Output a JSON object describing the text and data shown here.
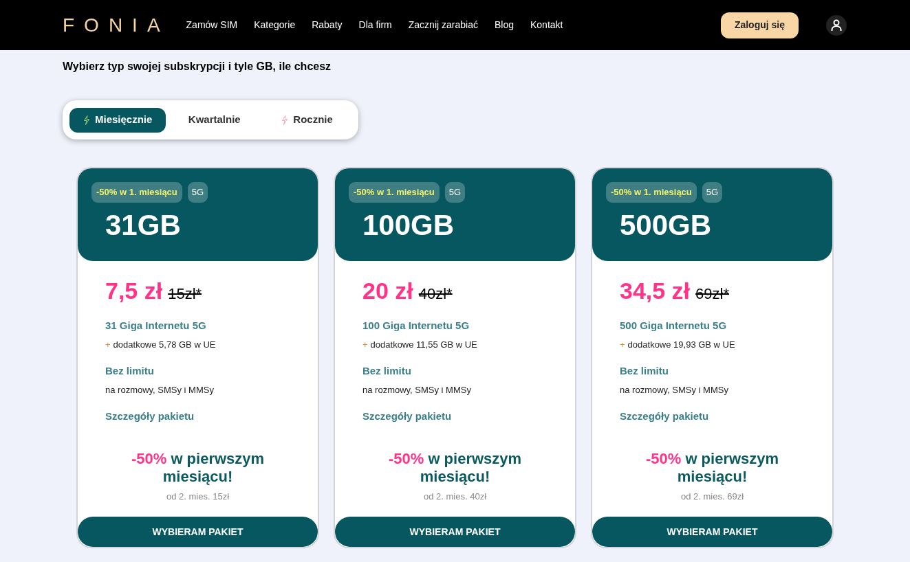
{
  "header": {
    "logo": "FONIA",
    "nav": [
      "Zamów SIM",
      "Kategorie",
      "Rabaty",
      "Dla firm",
      "Zacznij zarabiać",
      "Blog",
      "Kontakt"
    ],
    "login": "Zaloguj się"
  },
  "heading": "Wybierz typ swojej subskrypcji i tyle GB, ile chcesz",
  "tabs": [
    {
      "label": "Miesięcznie",
      "selected": true,
      "icon": true
    },
    {
      "label": "Kwartalnie",
      "selected": false,
      "icon": false
    },
    {
      "label": "Rocznie",
      "selected": false,
      "icon": true
    }
  ],
  "plans": [
    {
      "badge": "-50% w 1. miesiącu",
      "tag": "5G",
      "gb": "31GB",
      "price": "7,5 zł",
      "old_price": "15zł*",
      "data_title": "31 Giga Internetu 5G",
      "data_plus": "+",
      "data_extra": "dodatkowe 5,78 GB w UE",
      "limit_title": "Bez limitu",
      "limit_text": "na rozmowy, SMSy i MMSy",
      "details": "Szczegóły pakietu",
      "promo_highlight": "-50%",
      "promo_text": "w pierwszym miesiącu!",
      "after": "od 2. mies. 15zł",
      "button": "WYBIERAM PAKIET"
    },
    {
      "badge": "-50% w 1. miesiącu",
      "tag": "5G",
      "gb": "100GB",
      "price": "20 zł",
      "old_price": "40zł*",
      "data_title": "100 Giga Internetu 5G",
      "data_plus": "+",
      "data_extra": "dodatkowe 11,55 GB w UE",
      "limit_title": "Bez limitu",
      "limit_text": "na rozmowy, SMSy i MMSy",
      "details": "Szczegóły pakietu",
      "promo_highlight": "-50%",
      "promo_text": "w pierwszym miesiącu!",
      "after": "od 2. mies. 40zł",
      "button": "WYBIERAM PAKIET"
    },
    {
      "badge": "-50% w 1. miesiącu",
      "tag": "5G",
      "gb": "500GB",
      "price": "34,5 zł",
      "old_price": "69zł*",
      "data_title": "500 Giga Internetu 5G",
      "data_plus": "+",
      "data_extra": "dodatkowe 19,93 GB w UE",
      "limit_title": "Bez limitu",
      "limit_text": "na rozmowy, SMSy i MMSy",
      "details": "Szczegóły pakietu",
      "promo_highlight": "-50%",
      "promo_text": "w pierwszym miesiącu!",
      "after": "od 2. mies. 69zł",
      "button": "WYBIERAM PAKIET"
    }
  ]
}
